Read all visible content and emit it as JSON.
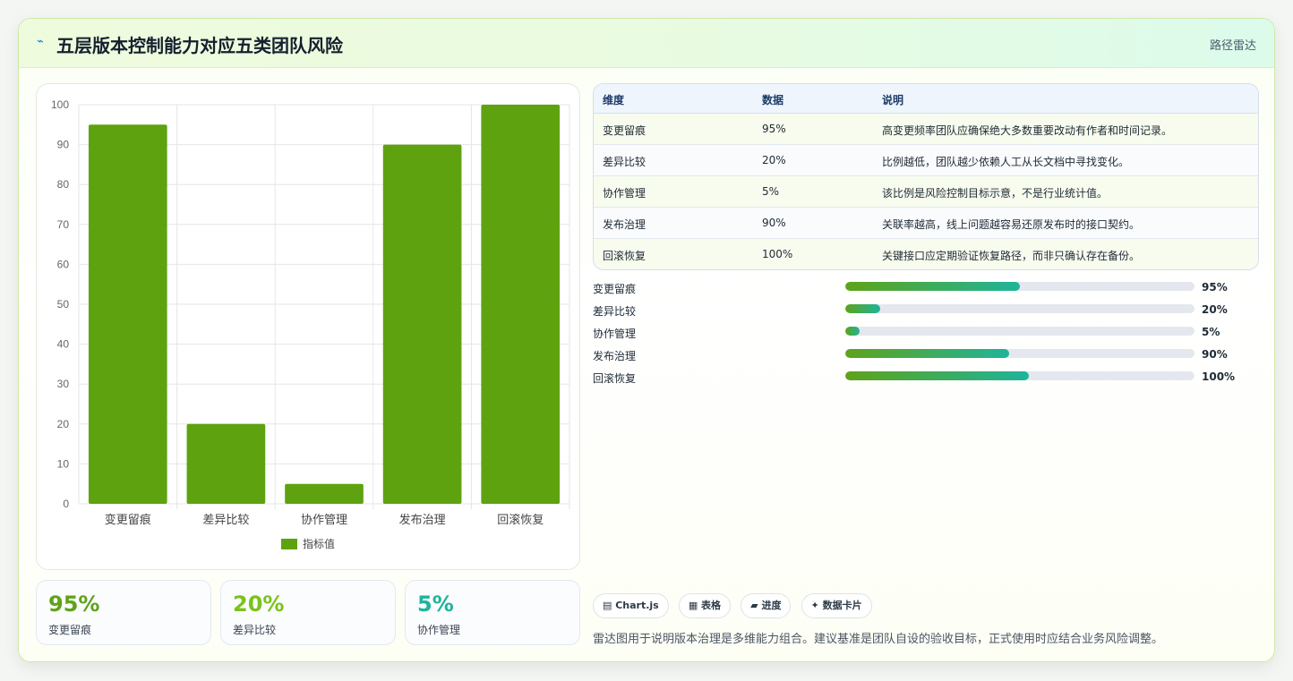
{
  "header": {
    "icon": "wave-icon",
    "title": "五层版本控制能力对应五类团队风险",
    "right_label": "路径雷达"
  },
  "chart_data": {
    "type": "bar",
    "categories": [
      "变更留痕",
      "差异比较",
      "协作管理",
      "发布治理",
      "回滚恢复"
    ],
    "series": [
      {
        "name": "指标值",
        "values": [
          95,
          20,
          5,
          90,
          100
        ],
        "color": "#5ea30f"
      }
    ],
    "ylim": [
      0,
      100
    ],
    "yticks": [
      0,
      10,
      20,
      30,
      40,
      50,
      60,
      70,
      80,
      90,
      100
    ],
    "grid": true,
    "legend": "bottom"
  },
  "stats": [
    {
      "value": "95%",
      "label": "变更留痕",
      "color": "#5ea31a"
    },
    {
      "value": "20%",
      "label": "差异比较",
      "color": "#7cc21d"
    },
    {
      "value": "5%",
      "label": "协作管理",
      "color": "#1db49a"
    }
  ],
  "table": {
    "headers": [
      "维度",
      "数据",
      "说明"
    ],
    "rows": [
      [
        "变更留痕",
        "95%",
        "高变更频率团队应确保绝大多数重要改动有作者和时间记录。"
      ],
      [
        "差异比较",
        "20%",
        "比例越低，团队越少依赖人工从长文档中寻找变化。"
      ],
      [
        "协作管理",
        "5%",
        "该比例是风险控制目标示意，不是行业统计值。"
      ],
      [
        "发布治理",
        "90%",
        "关联率越高，线上问题越容易还原发布时的接口契约。"
      ],
      [
        "回滚恢复",
        "100%",
        "关键接口应定期验证恢复路径，而非只确认存在备份。"
      ]
    ]
  },
  "progress": [
    {
      "label": "变更留痕",
      "value": "95%",
      "fill": 0.5
    },
    {
      "label": "差异比较",
      "value": "20%",
      "fill": 0.1
    },
    {
      "label": "协作管理",
      "value": "5%",
      "fill": 0.04
    },
    {
      "label": "发布治理",
      "value": "90%",
      "fill": 0.47
    },
    {
      "label": "回滚恢复",
      "value": "100%",
      "fill": 0.525
    }
  ],
  "tags": [
    {
      "icon": "chart-icon",
      "label": "▤ Chart.js"
    },
    {
      "icon": "table-icon",
      "label": "▦ 表格"
    },
    {
      "icon": "progress-icon",
      "label": "▰ 进度"
    },
    {
      "icon": "card-icon",
      "label": "✦ 数据卡片"
    }
  ],
  "note": "雷达图用于说明版本治理是多维能力组合。建议基准是团队自设的验收目标，正式使用时应结合业务风险调整。"
}
